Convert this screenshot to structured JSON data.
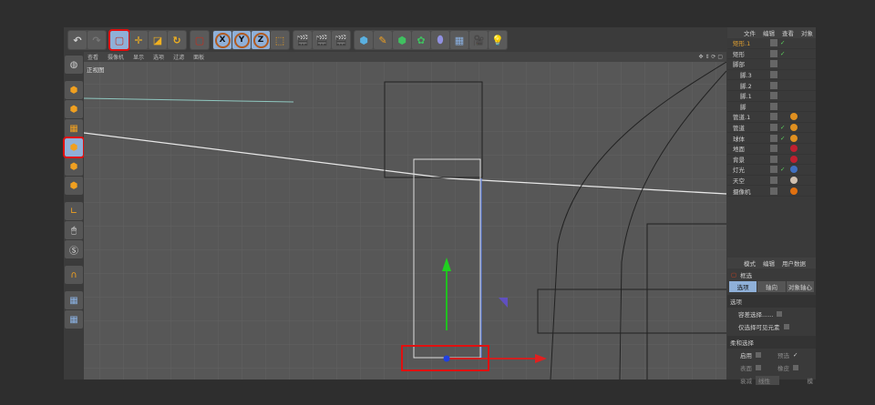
{
  "toolbar": {
    "groups": [
      [
        "undo-icon",
        "redo-icon"
      ],
      [
        "rect-select-icon",
        "move-icon",
        "scale-icon",
        "rotate-icon"
      ],
      [
        "live-select-icon"
      ],
      [
        "x-axis-icon",
        "y-axis-icon",
        "z-axis-icon",
        "world-coord-icon"
      ],
      [
        "render-view-icon",
        "render-picture-icon",
        "render-settings-icon"
      ],
      [
        "cube-icon",
        "pen-icon",
        "subdivide-icon",
        "array-icon",
        "deformer-icon",
        "floor-icon",
        "camera-icon",
        "light-icon"
      ]
    ],
    "axes": [
      "X",
      "Y",
      "Z"
    ]
  },
  "viewport": {
    "menu": [
      "查看",
      "摄像机",
      "显示",
      "选项",
      "过滤",
      "面板"
    ],
    "label": "正视图"
  },
  "objects": {
    "menu": [
      "文件",
      "编辑",
      "查看",
      "对象"
    ],
    "items": [
      {
        "name": "矩形.1",
        "indent": 0,
        "active": true,
        "check": true,
        "color": "#e0a030"
      },
      {
        "name": "矩形",
        "indent": 0,
        "check": true
      },
      {
        "name": "脚部",
        "indent": 0
      },
      {
        "name": "脚.3",
        "indent": 1
      },
      {
        "name": "脚.2",
        "indent": 1
      },
      {
        "name": "脚.1",
        "indent": 1
      },
      {
        "name": "脚",
        "indent": 1
      },
      {
        "name": "管道.1",
        "indent": 0,
        "tag": "#e09020"
      },
      {
        "name": "管道",
        "indent": 0,
        "check": true,
        "tag": "#e09020"
      },
      {
        "name": "球体",
        "indent": 0,
        "check": true,
        "tag": "#e09020"
      },
      {
        "name": "地面",
        "indent": 0,
        "tag": "#c02030"
      },
      {
        "name": "背景",
        "indent": 0,
        "tag": "#c02030"
      },
      {
        "name": "灯光",
        "indent": 0,
        "check": true,
        "tag": "#4070c0"
      },
      {
        "name": "天空",
        "indent": 0,
        "tag": "#d0c0b0"
      },
      {
        "name": "摄像机",
        "indent": 0,
        "tag": "#e07010"
      }
    ]
  },
  "attributes": {
    "menu": [
      "模式",
      "编辑",
      "用户数据"
    ],
    "tool": "框选",
    "tabs": [
      "选项",
      "轴向",
      "对象轴心"
    ],
    "section1": "选项",
    "opt1": "容差选择......",
    "opt2": "仅选择可见元素",
    "section2": "柔和选择",
    "enable": "启用",
    "preselect": "预选",
    "surface": "表面",
    "rubber": "橡皮",
    "falloff": "衰减",
    "falloff_value": "线性",
    "cut": "模"
  }
}
